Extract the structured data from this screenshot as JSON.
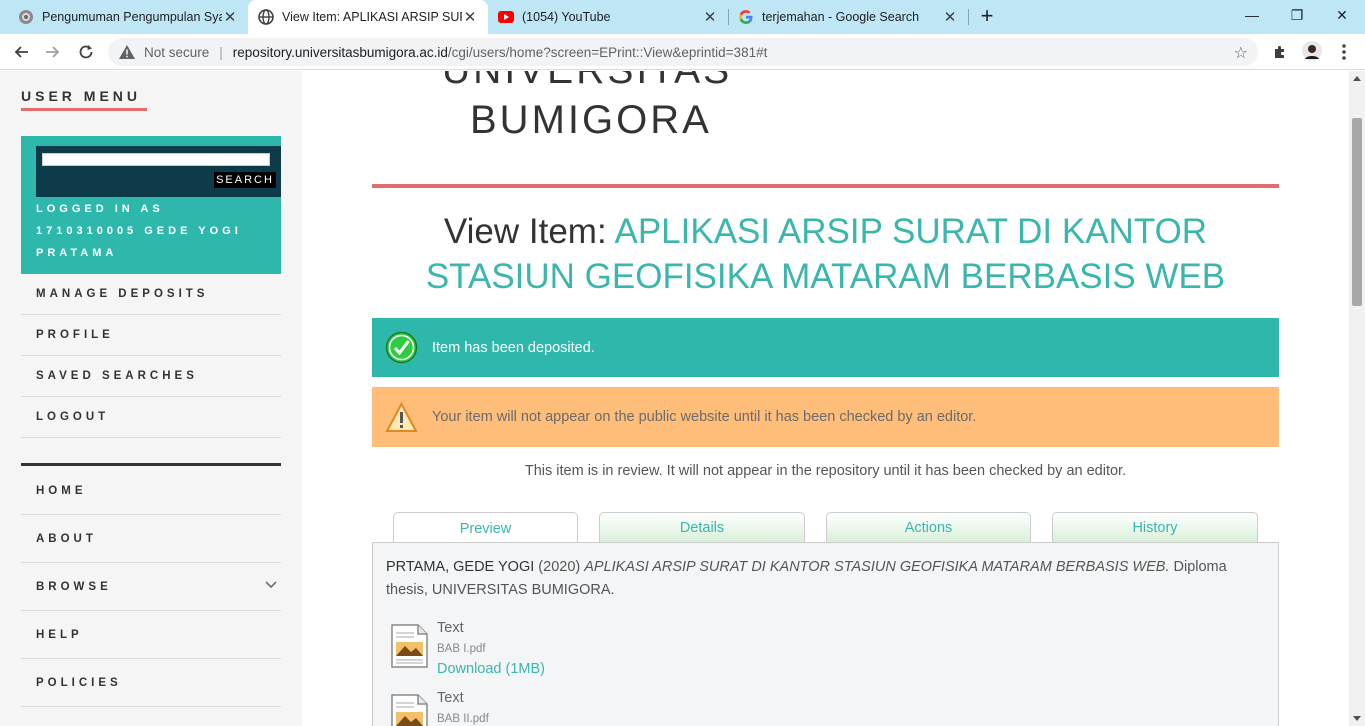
{
  "browser": {
    "tabs": [
      {
        "title": "Pengumuman Pengumpulan Syar",
        "icon": "site-seal-icon",
        "active": false
      },
      {
        "title": "View Item: APLIKASI ARSIP SURAT",
        "icon": "globe-icon",
        "active": true
      },
      {
        "title": "(1054) YouTube",
        "icon": "youtube-icon",
        "active": false
      },
      {
        "title": "terjemahan - Google Search",
        "icon": "google-icon",
        "active": false
      }
    ],
    "close_glyph": "✕",
    "new_tab_glyph": "+",
    "window_controls": {
      "minimize": "—",
      "restore": "❐",
      "close": "✕"
    },
    "address": {
      "security": "Not secure",
      "host": "repository.universitasbumigora.ac.id",
      "path": "/cgi/users/home?screen=EPrint::View&eprintid=381#t"
    }
  },
  "sidebar": {
    "user_menu_title": "USER MENU",
    "search_button": "SEARCH",
    "search_value": "",
    "logged_in_text": "LOGGED IN AS 1710310005 GEDE YOGI PRATAMA",
    "user_items": [
      {
        "label": "MANAGE DEPOSITS"
      },
      {
        "label": "PROFILE"
      },
      {
        "label": "SAVED SEARCHES"
      },
      {
        "label": "LOGOUT"
      }
    ],
    "nav_items": [
      {
        "label": "HOME"
      },
      {
        "label": "ABOUT"
      },
      {
        "label": "BROWSE",
        "has_chevron": true
      },
      {
        "label": "HELP"
      },
      {
        "label": "POLICIES"
      }
    ]
  },
  "header": {
    "uni_partial": "UNIVERSITAS",
    "uni_name": "BUMIGORA"
  },
  "main": {
    "title_prefix": "View Item:",
    "title_highlight": "APLIKASI ARSIP SURAT DI KANTOR STASIUN GEOFISIKA MATARAM BERBASIS WEB",
    "success_message": "Item has been deposited.",
    "warning_message": "Your item will not appear on the public website until it has been checked by an editor.",
    "review_text": "This item is in review. It will not appear in the repository until it has been checked by an editor.",
    "tabs": [
      {
        "label": "Preview",
        "active": true
      },
      {
        "label": "Details",
        "active": false
      },
      {
        "label": "Actions",
        "active": false
      },
      {
        "label": "History",
        "active": false
      }
    ],
    "citation": {
      "author": "PRTAMA, GEDE YOGI",
      "year": "(2020)",
      "title": "APLIKASI ARSIP SURAT DI KANTOR STASIUN GEOFISIKA MATARAM BERBASIS WEB.",
      "rest": "Diploma thesis, UNIVERSITAS BUMIGORA."
    },
    "documents": [
      {
        "type": "Text",
        "filename": "BAB I.pdf",
        "download": "Download (1MB)"
      },
      {
        "type": "Text",
        "filename": "BAB II.pdf",
        "download": ""
      }
    ]
  },
  "colors": {
    "teal": "#2eb8ac",
    "accent_red": "#e36d6d",
    "warning_orange": "#ffbd7a",
    "link_teal": "#3bb6ac",
    "tabbar_blue": "#bfe6f5"
  }
}
